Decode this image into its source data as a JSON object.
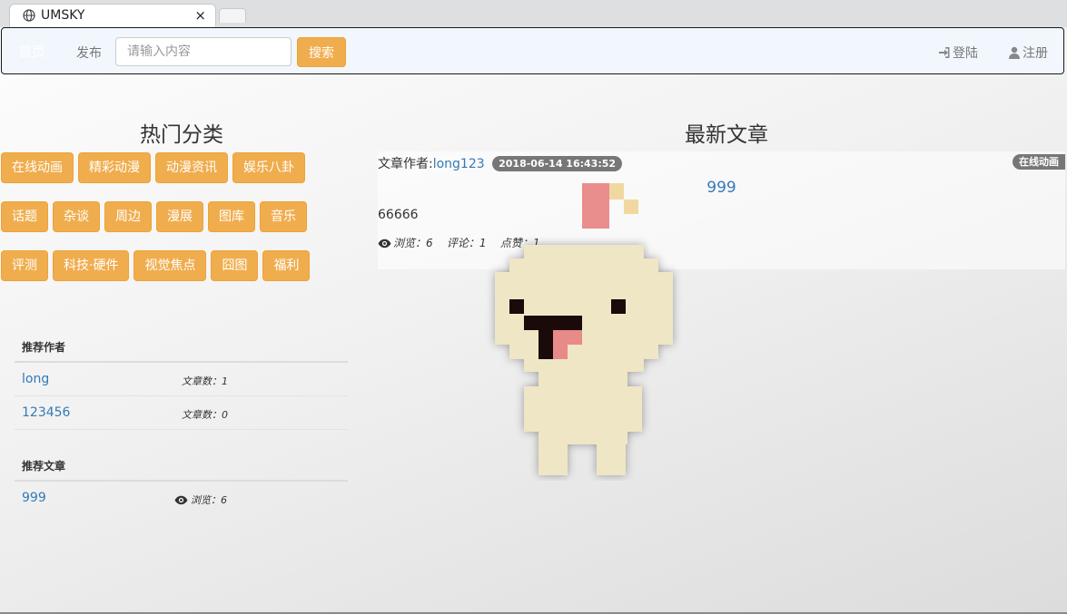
{
  "browser": {
    "tab_title": "UMSKY",
    "close_glyph": "×"
  },
  "navbar": {
    "brand": "首页",
    "publish": "发布",
    "search_placeholder": "请输入内容",
    "search_button": "搜索",
    "login": "登陆",
    "register": "注册"
  },
  "hot_categories": {
    "title": "热门分类",
    "rows": [
      [
        "在线动画",
        "精彩动漫",
        "动漫资讯",
        "娱乐八卦"
      ],
      [
        "话题",
        "杂谈",
        "周边",
        "漫展",
        "图库",
        "音乐"
      ],
      [
        "评测",
        "科技·硬件",
        "视觉焦点",
        "囧图",
        "福利"
      ]
    ]
  },
  "recommended_authors": {
    "title": "推荐作者",
    "items": [
      {
        "name": "long",
        "meta": "文章数：1"
      },
      {
        "name": "123456",
        "meta": "文章数：0"
      }
    ]
  },
  "recommended_articles": {
    "title": "推荐文章",
    "items": [
      {
        "name": "999",
        "meta": "浏览：6"
      }
    ]
  },
  "latest_articles": {
    "title": "最新文章",
    "items": [
      {
        "author_label": "文章作者:",
        "author": "long123",
        "date": "2018-06-14 16:43:52",
        "category": "在线动画",
        "title": "999",
        "summary": "66666",
        "views": "浏览：6",
        "comments": "评论：1",
        "likes": "点赞：1"
      }
    ]
  },
  "colors": {
    "accent_orange": "#f0ad4e",
    "link_blue": "#337ab7",
    "badge_gray": "#777777",
    "navbar_bg": "#f1f7fd"
  },
  "icons": [
    "globe-icon",
    "close-icon",
    "login-icon",
    "user-icon",
    "eye-icon"
  ]
}
